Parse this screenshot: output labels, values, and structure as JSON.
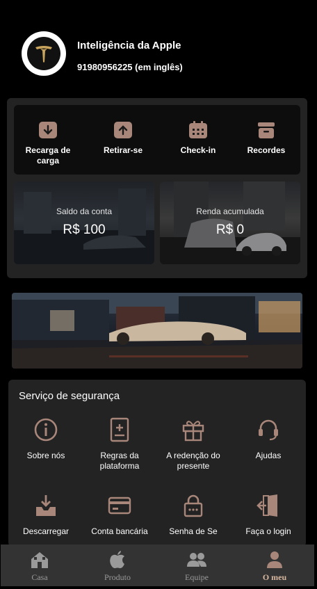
{
  "user": {
    "name": "Inteligência da Apple",
    "phone": "91980956225 (em inglês)"
  },
  "actions": [
    {
      "label": "Recarga de carga",
      "icon": "recharge-icon"
    },
    {
      "label": "Retirar-se",
      "icon": "withdraw-icon"
    },
    {
      "label": "Check-in",
      "icon": "calendar-icon"
    },
    {
      "label": "Recordes",
      "icon": "records-icon"
    }
  ],
  "balance": {
    "account_title": "Saldo da conta",
    "account_value": "R$ 100",
    "income_title": "Renda acumulada",
    "income_value": "R$ 0"
  },
  "service": {
    "title": "Serviço de segurança",
    "items": [
      {
        "label": "Sobre nós",
        "icon": "info-icon"
      },
      {
        "label": "Regras da plataforma",
        "icon": "rules-icon"
      },
      {
        "label": "A redenção do presente",
        "icon": "gift-icon"
      },
      {
        "label": "Ajudas",
        "icon": "headset-icon"
      },
      {
        "label": "Descarregar",
        "icon": "download-icon"
      },
      {
        "label": "Conta bancária",
        "icon": "bank-card-icon"
      },
      {
        "label": "Senha de Se",
        "icon": "lock-icon"
      },
      {
        "label": "Faça o login",
        "icon": "logout-icon"
      }
    ]
  },
  "tabs": [
    {
      "label": "Casa",
      "icon": "home-icon"
    },
    {
      "label": "Produto",
      "icon": "apple-icon"
    },
    {
      "label": "Equipe",
      "icon": "team-icon"
    },
    {
      "label": "O meu",
      "icon": "user-icon"
    }
  ],
  "colors": {
    "accent": "#a8867a",
    "tab_active": "#d9b8a0",
    "background": "#000000",
    "panel": "#232323"
  }
}
